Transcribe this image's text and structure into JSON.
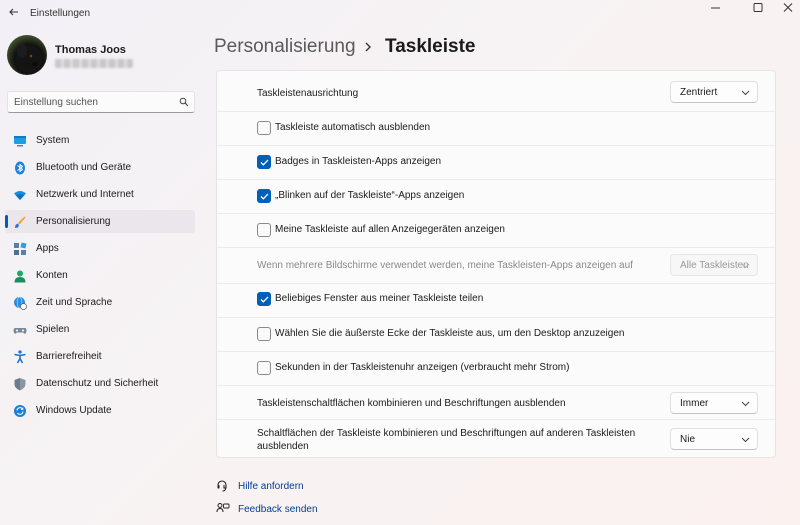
{
  "window": {
    "title": "Einstellungen"
  },
  "user": {
    "name": "Thomas Joos"
  },
  "search": {
    "placeholder": "Einstellung suchen"
  },
  "sidebar": {
    "items": [
      {
        "label": "System",
        "icon": "system-icon"
      },
      {
        "label": "Bluetooth und Geräte",
        "icon": "bluetooth-icon"
      },
      {
        "label": "Netzwerk und Internet",
        "icon": "wifi-icon"
      },
      {
        "label": "Personalisierung",
        "icon": "brush-icon",
        "selected": true
      },
      {
        "label": "Apps",
        "icon": "apps-icon"
      },
      {
        "label": "Konten",
        "icon": "account-icon"
      },
      {
        "label": "Zeit und Sprache",
        "icon": "globe-clock-icon"
      },
      {
        "label": "Spielen",
        "icon": "gamepad-icon"
      },
      {
        "label": "Barrierefreiheit",
        "icon": "accessibility-icon"
      },
      {
        "label": "Datenschutz und Sicherheit",
        "icon": "shield-icon"
      },
      {
        "label": "Windows Update",
        "icon": "update-icon"
      }
    ]
  },
  "header": {
    "parent": "Personalisierung",
    "current": "Taskleiste"
  },
  "settings": {
    "alignment": {
      "label": "Taskleistenausrichtung",
      "value": "Zentriert"
    },
    "checkboxes": [
      {
        "label": "Taskleiste automatisch ausblenden",
        "checked": false
      },
      {
        "label": "Badges in Taskleisten-Apps anzeigen",
        "checked": true
      },
      {
        "label": "„Blinken auf der Taskleiste“-Apps anzeigen",
        "checked": true
      },
      {
        "label": "Meine Taskleiste auf allen Anzeigegeräten anzeigen",
        "checked": false
      }
    ],
    "multi_monitor": {
      "label": "Wenn mehrere Bildschirme verwendet werden, meine Taskleisten-Apps anzeigen auf",
      "value": "Alle Taskleisten",
      "disabled": true
    },
    "checkboxes2": [
      {
        "label": "Beliebiges Fenster aus meiner Taskleiste teilen",
        "checked": true
      },
      {
        "label": "Wählen Sie die äußerste Ecke der Taskleiste aus, um den Desktop anzuzeigen",
        "checked": false
      },
      {
        "label": "Sekunden in der Taskleistenuhr anzeigen (verbraucht mehr Strom)",
        "checked": false
      }
    ],
    "combine": {
      "label": "Taskleistenschaltflächen kombinieren und Beschriftungen ausblenden",
      "value": "Immer"
    },
    "combine_other": {
      "label_line1": "Schaltflächen der Taskleiste kombinieren und Beschriftungen auf anderen Taskleisten",
      "label_line2": "ausblenden",
      "value": "Nie"
    }
  },
  "links": {
    "help": "Hilfe anfordern",
    "feedback": "Feedback senden"
  },
  "colors": {
    "accent": "#005fb8",
    "link": "#003e92"
  }
}
